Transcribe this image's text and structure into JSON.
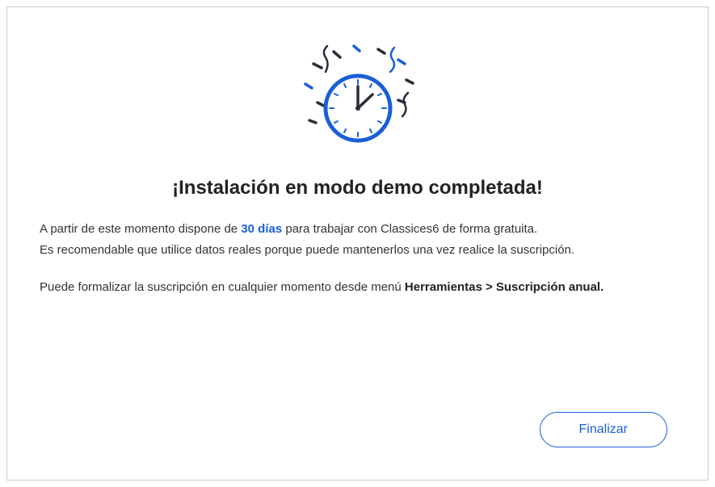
{
  "title": "¡Instalación en modo demo completada!",
  "body": {
    "line1_pre": "A partir de este momento dispone de ",
    "trial_days": "30 días",
    "line1_post": " para trabajar con Classices6 de forma gratuita.",
    "line2": "Es recomendable que utilice datos reales porque puede mantenerlos una vez realice la suscripción.",
    "line3_pre": "Puede formalizar la suscripción en cualquier momento desde menú ",
    "menu_path": "Herramientas > Suscripción anual."
  },
  "footer": {
    "finalize_label": "Finalizar"
  },
  "colors": {
    "accent": "#1a5fd6",
    "dark": "#2c2c3a"
  }
}
